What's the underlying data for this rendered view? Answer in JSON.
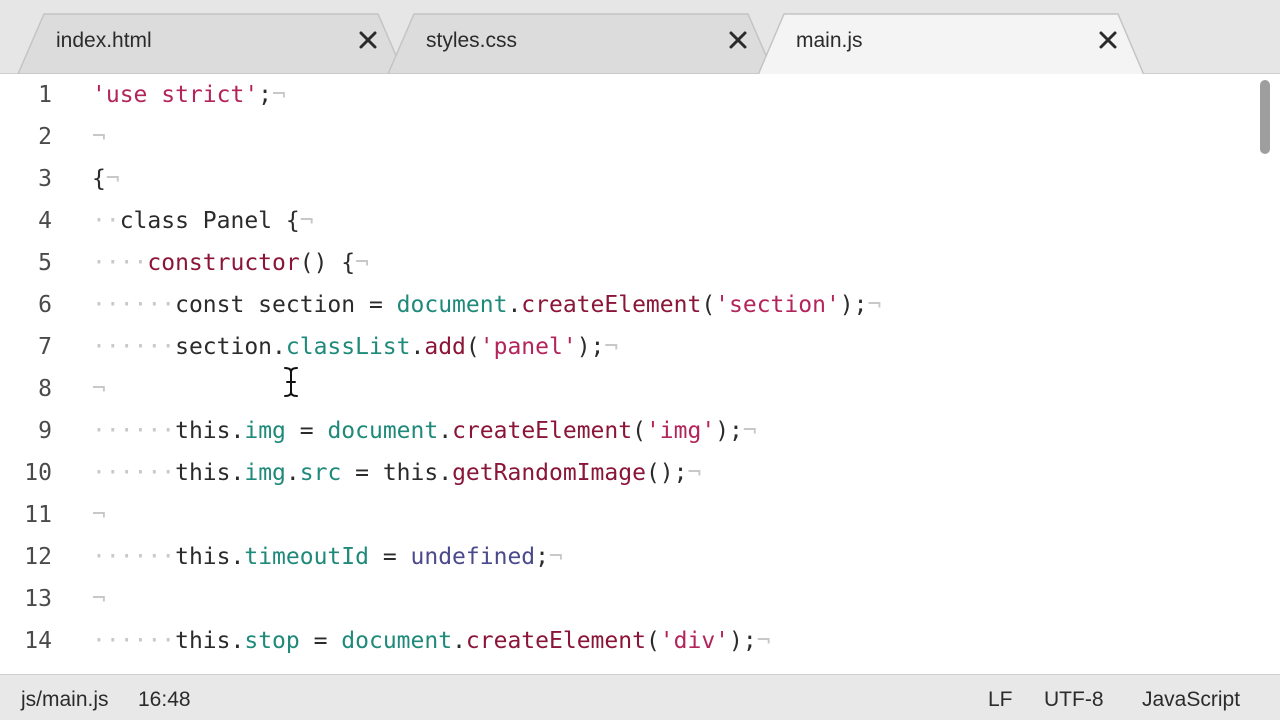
{
  "tabs": [
    {
      "label": "index.html",
      "active": false
    },
    {
      "label": "styles.css",
      "active": false
    },
    {
      "label": "main.js",
      "active": true
    }
  ],
  "editor": {
    "lines": [
      {
        "number": "1",
        "tokens": [
          {
            "t": "'use strict'",
            "c": "str"
          },
          {
            "t": ";",
            "c": "def"
          },
          {
            "t": "¬",
            "c": "eol"
          }
        ]
      },
      {
        "number": "2",
        "tokens": [
          {
            "t": "¬",
            "c": "eol"
          }
        ]
      },
      {
        "number": "3",
        "tokens": [
          {
            "t": "{",
            "c": "def"
          },
          {
            "t": "¬",
            "c": "eol"
          }
        ]
      },
      {
        "number": "4",
        "tokens": [
          {
            "t": "··",
            "c": "ws"
          },
          {
            "t": "class Panel {",
            "c": "def"
          },
          {
            "t": "¬",
            "c": "eol"
          }
        ]
      },
      {
        "number": "5",
        "tokens": [
          {
            "t": "····",
            "c": "ws"
          },
          {
            "t": "constructor",
            "c": "fn"
          },
          {
            "t": "() {",
            "c": "def"
          },
          {
            "t": "¬",
            "c": "eol"
          }
        ]
      },
      {
        "number": "6",
        "tokens": [
          {
            "t": "······",
            "c": "ws"
          },
          {
            "t": "const section = ",
            "c": "def"
          },
          {
            "t": "document",
            "c": "prop"
          },
          {
            "t": ".",
            "c": "def"
          },
          {
            "t": "createElement",
            "c": "fn"
          },
          {
            "t": "(",
            "c": "def"
          },
          {
            "t": "'section'",
            "c": "str"
          },
          {
            "t": ");",
            "c": "def"
          },
          {
            "t": "¬",
            "c": "eol"
          }
        ]
      },
      {
        "number": "7",
        "tokens": [
          {
            "t": "······",
            "c": "ws"
          },
          {
            "t": "section.",
            "c": "def"
          },
          {
            "t": "classList",
            "c": "prop"
          },
          {
            "t": ".",
            "c": "def"
          },
          {
            "t": "add",
            "c": "fn"
          },
          {
            "t": "(",
            "c": "def"
          },
          {
            "t": "'panel'",
            "c": "str"
          },
          {
            "t": ");",
            "c": "def"
          },
          {
            "t": "¬",
            "c": "eol"
          }
        ]
      },
      {
        "number": "8",
        "tokens": [
          {
            "t": "¬",
            "c": "eol"
          }
        ]
      },
      {
        "number": "9",
        "tokens": [
          {
            "t": "······",
            "c": "ws"
          },
          {
            "t": "this.",
            "c": "def"
          },
          {
            "t": "img",
            "c": "prop"
          },
          {
            "t": " = ",
            "c": "def"
          },
          {
            "t": "document",
            "c": "prop"
          },
          {
            "t": ".",
            "c": "def"
          },
          {
            "t": "createElement",
            "c": "fn"
          },
          {
            "t": "(",
            "c": "def"
          },
          {
            "t": "'img'",
            "c": "str"
          },
          {
            "t": ");",
            "c": "def"
          },
          {
            "t": "¬",
            "c": "eol"
          }
        ]
      },
      {
        "number": "10",
        "tokens": [
          {
            "t": "······",
            "c": "ws"
          },
          {
            "t": "this.",
            "c": "def"
          },
          {
            "t": "img",
            "c": "prop"
          },
          {
            "t": ".",
            "c": "def"
          },
          {
            "t": "src",
            "c": "prop"
          },
          {
            "t": " = this.",
            "c": "def"
          },
          {
            "t": "getRandomImage",
            "c": "fn"
          },
          {
            "t": "();",
            "c": "def"
          },
          {
            "t": "¬",
            "c": "eol"
          }
        ]
      },
      {
        "number": "11",
        "tokens": [
          {
            "t": "¬",
            "c": "eol"
          }
        ]
      },
      {
        "number": "12",
        "tokens": [
          {
            "t": "······",
            "c": "ws"
          },
          {
            "t": "this.",
            "c": "def"
          },
          {
            "t": "timeoutId",
            "c": "prop"
          },
          {
            "t": " = ",
            "c": "def"
          },
          {
            "t": "undefined",
            "c": "kw"
          },
          {
            "t": ";",
            "c": "def"
          },
          {
            "t": "¬",
            "c": "eol"
          }
        ]
      },
      {
        "number": "13",
        "tokens": [
          {
            "t": "¬",
            "c": "eol"
          }
        ]
      },
      {
        "number": "14",
        "tokens": [
          {
            "t": "······",
            "c": "ws"
          },
          {
            "t": "this.",
            "c": "def"
          },
          {
            "t": "stop",
            "c": "prop"
          },
          {
            "t": " = ",
            "c": "def"
          },
          {
            "t": "document",
            "c": "prop"
          },
          {
            "t": ".",
            "c": "def"
          },
          {
            "t": "createElement",
            "c": "fn"
          },
          {
            "t": "(",
            "c": "def"
          },
          {
            "t": "'div'",
            "c": "str"
          },
          {
            "t": ");",
            "c": "def"
          },
          {
            "t": "¬",
            "c": "eol"
          }
        ]
      }
    ]
  },
  "status": {
    "file_path": "js/main.js",
    "cursor_position": "16:48",
    "line_ending": "LF",
    "encoding": "UTF-8",
    "language": "JavaScript"
  },
  "icons": {
    "tab_close": "close-icon",
    "text_cursor": "i-beam-cursor-icon"
  },
  "colors": {
    "string": "#b3245a",
    "property": "#1f8a7a",
    "function": "#8a1538",
    "keyword": "#4a4a8c",
    "invisible": "#c8c8c8"
  }
}
